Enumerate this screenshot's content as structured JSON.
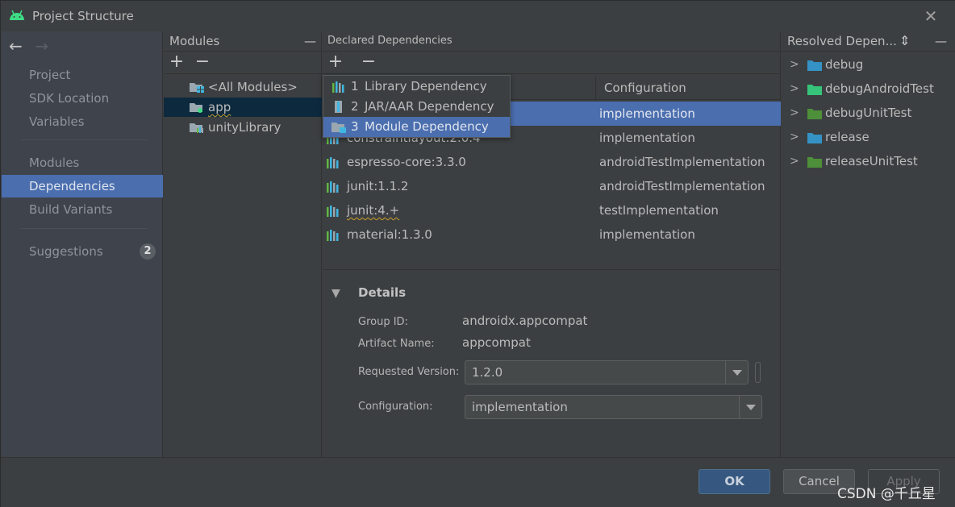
{
  "window": {
    "title": "Project Structure",
    "close_glyph": "✕"
  },
  "nav": {
    "back_glyph": "←",
    "forward_glyph": "→",
    "items": [
      {
        "label": "Project"
      },
      {
        "label": "SDK Location"
      },
      {
        "label": "Variables"
      },
      {
        "label": "Modules"
      },
      {
        "label": "Dependencies",
        "selected": true
      },
      {
        "label": "Build Variants"
      },
      {
        "label": "Suggestions",
        "badge": "2"
      }
    ]
  },
  "modules_panel": {
    "title": "Modules",
    "add_glyph": "+",
    "remove_glyph": "−",
    "collapse_glyph": "—",
    "items": [
      {
        "label": "<All Modules>",
        "icon": "all-modules-icon"
      },
      {
        "label": "app",
        "icon": "app-module-icon",
        "selected": true
      },
      {
        "label": "unityLibrary",
        "icon": "library-module-icon"
      }
    ]
  },
  "declared_panel": {
    "title": "Declared Dependencies",
    "add_glyph": "+",
    "remove_glyph": "−",
    "column_configuration": "Configuration",
    "rows": [
      {
        "name": "",
        "configuration": "implementation",
        "selected": true
      },
      {
        "name": "constraintlayout:2.0.4",
        "configuration": "implementation"
      },
      {
        "name": "espresso-core:3.3.0",
        "configuration": "androidTestImplementation"
      },
      {
        "name": "junit:1.1.2",
        "configuration": "androidTestImplementation"
      },
      {
        "name": "junit:4.+",
        "configuration": "testImplementation",
        "warning": true
      },
      {
        "name": "material:1.3.0",
        "configuration": "implementation"
      }
    ],
    "popup": [
      {
        "num": "1",
        "label": "Library Dependency",
        "icon": "library-icon"
      },
      {
        "num": "2",
        "label": "JAR/AAR Dependency",
        "icon": "jar-icon"
      },
      {
        "num": "3",
        "label": "Module Dependency",
        "icon": "module-icon",
        "selected": true
      }
    ]
  },
  "details": {
    "heading": "Details",
    "group_id_label": "Group ID:",
    "group_id": "androidx.appcompat",
    "artifact_label": "Artifact Name:",
    "artifact": "appcompat",
    "version_label": "Requested Version:",
    "version": "1.2.0",
    "config_label": "Configuration:",
    "config": "implementation"
  },
  "resolved_panel": {
    "title": "Resolved Depen...",
    "collapse_all_glyph": "⇞",
    "minimize_glyph": "—",
    "items": [
      {
        "label": "debug",
        "color": "#3592c4"
      },
      {
        "label": "debugAndroidTest",
        "color": "#35c47a"
      },
      {
        "label": "debugUnitTest",
        "color": "#4e8f3a"
      },
      {
        "label": "release",
        "color": "#3592c4"
      },
      {
        "label": "releaseUnitTest",
        "color": "#4e8f3a"
      }
    ]
  },
  "buttons": {
    "ok": "OK",
    "cancel": "Cancel",
    "apply": "Apply"
  },
  "watermark": "CSDN @千丘星",
  "colors": {
    "selection": "#4b6eaf",
    "inactive_selection": "#0d293e",
    "android_green": "#3ddc84"
  }
}
